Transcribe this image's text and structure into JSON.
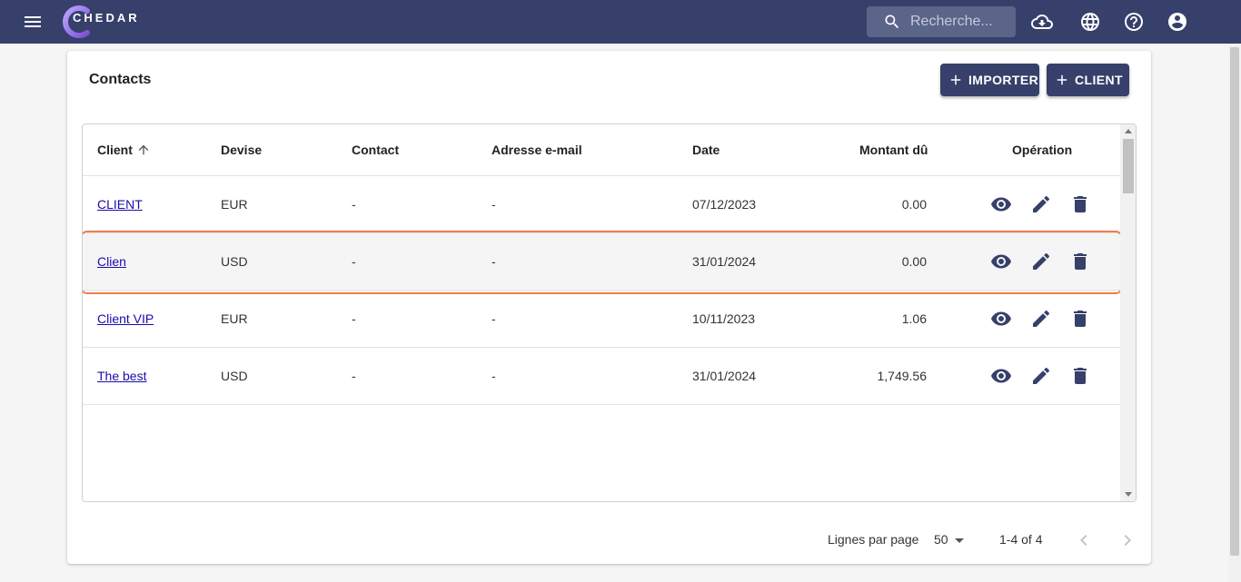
{
  "brand": {
    "name": "CHEDAR"
  },
  "search": {
    "placeholder": "Recherche..."
  },
  "page": {
    "title": "Contacts",
    "import_label": "IMPORTER",
    "client_label": "CLIENT"
  },
  "table": {
    "headers": {
      "client": "Client",
      "devise": "Devise",
      "contact": "Contact",
      "email": "Adresse e-mail",
      "date": "Date",
      "montant": "Montant dû",
      "operation": "Opération"
    },
    "rows": [
      {
        "client": "CLIENT",
        "devise": "EUR",
        "contact": "-",
        "email": "-",
        "date": "07/12/2023",
        "montant": "0.00"
      },
      {
        "client": "Clien",
        "devise": "USD",
        "contact": "-",
        "email": "-",
        "date": "31/01/2024",
        "montant": "0.00"
      },
      {
        "client": "Client VIP",
        "devise": "EUR",
        "contact": "-",
        "email": "-",
        "date": "10/11/2023",
        "montant": "1.06"
      },
      {
        "client": "The best",
        "devise": "USD",
        "contact": "-",
        "email": "-",
        "date": "31/01/2024",
        "montant": "1,749.56"
      }
    ]
  },
  "pagination": {
    "rows_per_page_label": "Lignes par page",
    "rows_per_page": "50",
    "range": "1-4 of 4"
  },
  "icons": {
    "menu": "menu-icon",
    "search": "search-icon",
    "cloud": "cloud-download-icon",
    "language": "globe-icon",
    "help": "help-icon",
    "account": "account-icon",
    "view": "eye-icon",
    "edit": "pencil-icon",
    "delete": "trash-icon"
  },
  "colors": {
    "header_bg": "#36406a",
    "button_bg": "#36406a",
    "highlight": "#ef7d4a",
    "link": "#1a0dab"
  }
}
